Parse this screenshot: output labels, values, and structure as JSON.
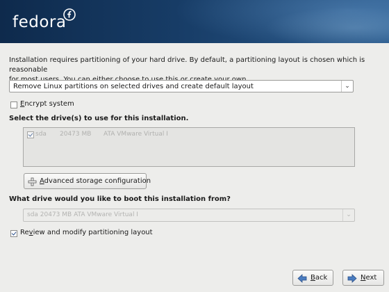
{
  "header": {
    "logo_text": "fedora"
  },
  "intro": {
    "line1": "Installation requires partitioning of your hard drive.  By default, a partitioning layout is chosen which is reasonable",
    "line2": "for most users.  You can either choose to use this or create your own."
  },
  "layout_select": {
    "value": "Remove Linux partitions on selected drives and create default layout"
  },
  "encrypt": {
    "label_u": "E",
    "label_rest": "ncrypt system",
    "checked": false
  },
  "drives": {
    "heading": "Select the drive(s) to use for this installation.",
    "items": [
      {
        "checked": true,
        "name": "sda",
        "size": "20473 MB",
        "model": "ATA VMware Virtual I"
      }
    ]
  },
  "advanced_button": {
    "label_u": "A",
    "label_rest": "dvanced storage configuration"
  },
  "boot": {
    "heading": "What drive would you like to boot this installation from?",
    "value": "sda    20473 MB ATA VMware Virtual I"
  },
  "review": {
    "label_pre": "Re",
    "label_u": "v",
    "label_rest": "iew and modify partitioning layout",
    "checked": true
  },
  "nav": {
    "back_u": "B",
    "back_rest": "ack",
    "next_u": "N",
    "next_rest": "ext"
  }
}
